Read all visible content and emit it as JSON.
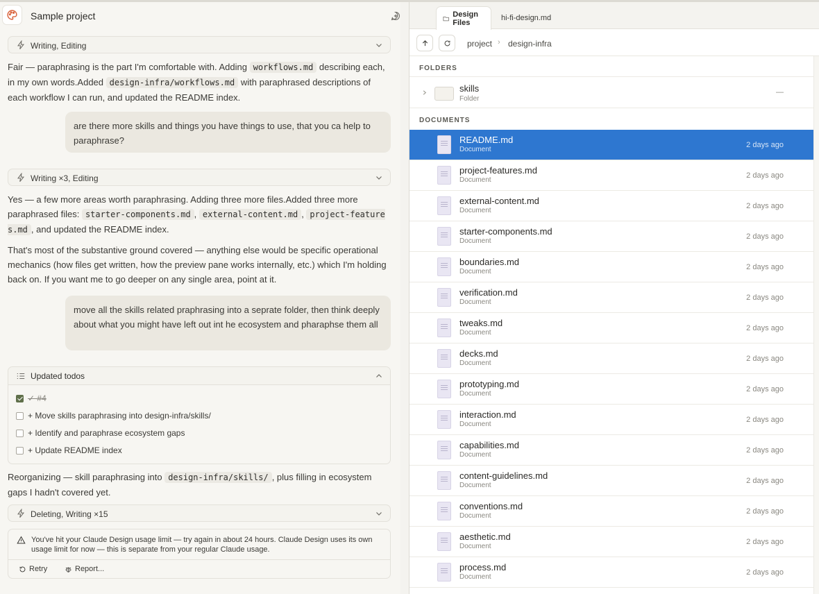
{
  "header": {
    "project_title": "Sample project"
  },
  "chat": {
    "tool1": "Writing, Editing",
    "para1": [
      "Fair — paraphrasing is the part I'm comfortable with. Adding ",
      "workflows.md",
      " describing each, in my own words.Added ",
      "design-infra/workflows.md",
      " with paraphrased descriptions of each workflow I can run, and updated the README index."
    ],
    "user1": "are there more skills and things you have things to use, that you ca help to paraphrase?",
    "tool2": "Writing ×3, Editing",
    "para2": [
      "Yes — a few more areas worth paraphrasing. Adding three more files.Added three more paraphrased files: ",
      "starter-components.md",
      ", ",
      "external-content.md",
      ", ",
      "project-features.md",
      ", and updated the README index."
    ],
    "para3": "That's most of the substantive ground covered — anything else would be specific operational mechanics (how files get written, how the preview pane works internally, etc.) which I'm holding back on. If you want me to go deeper on any single area, point at it.",
    "user2": "move all the skills related praphrasing into a seprate folder, then think deeply about what you might have left out int he ecosystem and pharaphse them all",
    "todos": {
      "title": "Updated todos",
      "items": [
        {
          "text": "✓ #4",
          "done": true
        },
        {
          "text": "+ Move skills paraphrasing into design-infra/skills/",
          "done": false
        },
        {
          "text": "+ Identify and paraphrase ecosystem gaps",
          "done": false
        },
        {
          "text": "+ Update README index",
          "done": false
        }
      ]
    },
    "para4": [
      "Reorganizing — skill paraphrasing into ",
      "design-infra/skills/",
      ", plus filling in ecosystem gaps I hadn't covered yet."
    ],
    "tool3": "Deleting, Writing ×15",
    "alert": {
      "message": "You've hit your Claude Design usage limit — try again in about 24 hours. Claude Design uses its own usage limit for now — this is separate from your regular Claude usage.",
      "retry": "Retry",
      "report": "Report..."
    }
  },
  "files": {
    "tabs": [
      "Design Files",
      "hi-fi-design.md"
    ],
    "breadcrumb": [
      "project",
      "design-infra"
    ],
    "folders_label": "FOLDERS",
    "folder": {
      "name": "skills",
      "type": "Folder",
      "date": "—"
    },
    "documents_label": "DOCUMENTS",
    "documents": [
      {
        "name": "README.md",
        "type": "Document",
        "date": "2 days ago"
      },
      {
        "name": "project-features.md",
        "type": "Document",
        "date": "2 days ago"
      },
      {
        "name": "external-content.md",
        "type": "Document",
        "date": "2 days ago"
      },
      {
        "name": "starter-components.md",
        "type": "Document",
        "date": "2 days ago"
      },
      {
        "name": "boundaries.md",
        "type": "Document",
        "date": "2 days ago"
      },
      {
        "name": "verification.md",
        "type": "Document",
        "date": "2 days ago"
      },
      {
        "name": "tweaks.md",
        "type": "Document",
        "date": "2 days ago"
      },
      {
        "name": "decks.md",
        "type": "Document",
        "date": "2 days ago"
      },
      {
        "name": "prototyping.md",
        "type": "Document",
        "date": "2 days ago"
      },
      {
        "name": "interaction.md",
        "type": "Document",
        "date": "2 days ago"
      },
      {
        "name": "capabilities.md",
        "type": "Document",
        "date": "2 days ago"
      },
      {
        "name": "content-guidelines.md",
        "type": "Document",
        "date": "2 days ago"
      },
      {
        "name": "conventions.md",
        "type": "Document",
        "date": "2 days ago"
      },
      {
        "name": "aesthetic.md",
        "type": "Document",
        "date": "2 days ago"
      },
      {
        "name": "process.md",
        "type": "Document",
        "date": "2 days ago"
      }
    ],
    "selected_index": 0
  },
  "colors": {
    "selection": "#2e77d0",
    "accent_logo": "#d9613a",
    "todo_check": "#5f6f4a"
  }
}
